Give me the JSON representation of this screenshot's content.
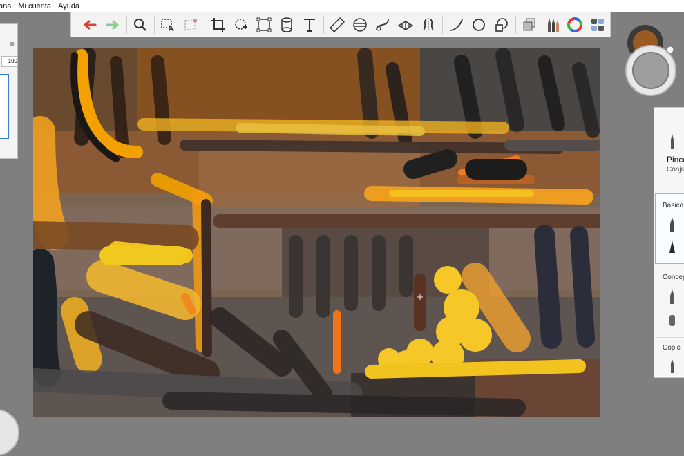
{
  "menu": {
    "items": [
      "ana",
      "Mi cuenta",
      "Ayuda"
    ]
  },
  "toolbar": {
    "tools": [
      "undo-icon",
      "redo-icon",
      "zoom-icon",
      "select-icon",
      "lasso-select-icon",
      "crop-icon",
      "transform-icon",
      "distort-icon",
      "cylinder-icon",
      "text-icon",
      "ruler-icon",
      "ellipse-guide-icon",
      "curve-guide-icon",
      "perspective-guide-icon",
      "symmetry-icon",
      "stroke-icon",
      "circle-icon",
      "shape-icon",
      "layers-icon",
      "brushes-icon",
      "color-wheel-icon",
      "library-icon"
    ]
  },
  "left_panel": {
    "value": "100"
  },
  "colors": {
    "accent": "#3a7bd5",
    "undo": "#d94031",
    "redo": "#8bd08a"
  },
  "brush_panel": {
    "title": "Pince",
    "subtitle": "Conju",
    "sections": [
      "Básico",
      "Concep",
      "Copic"
    ]
  }
}
